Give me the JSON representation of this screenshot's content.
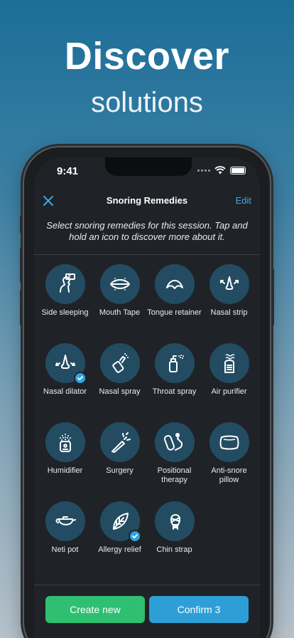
{
  "promo": {
    "title": "Discover",
    "subtitle": "solutions"
  },
  "status_bar": {
    "time": "9:41"
  },
  "nav": {
    "title": "Snoring Remedies",
    "edit_label": "Edit",
    "close_icon": "close-icon"
  },
  "instructions": "Select snoring remedies for this session. Tap and hold an icon to discover more about it.",
  "remedies": [
    {
      "label": "Side sleeping",
      "icon": "side-sleeping-icon",
      "selected": false
    },
    {
      "label": "Mouth Tape",
      "icon": "mouth-tape-icon",
      "selected": false
    },
    {
      "label": "Tongue retainer",
      "icon": "tongue-retainer-icon",
      "selected": false
    },
    {
      "label": "Nasal strip",
      "icon": "nasal-strip-icon",
      "selected": false
    },
    {
      "label": "Nasal dilator",
      "icon": "nasal-dilator-icon",
      "selected": true
    },
    {
      "label": "Nasal spray",
      "icon": "nasal-spray-icon",
      "selected": false
    },
    {
      "label": "Throat spray",
      "icon": "throat-spray-icon",
      "selected": false
    },
    {
      "label": "Air purifier",
      "icon": "air-purifier-icon",
      "selected": false
    },
    {
      "label": "Humidifier",
      "icon": "humidifier-icon",
      "selected": false
    },
    {
      "label": "Surgery",
      "icon": "surgery-icon",
      "selected": false
    },
    {
      "label": "Positional therapy",
      "icon": "positional-therapy-icon",
      "selected": false
    },
    {
      "label": "Anti-snore pillow",
      "icon": "anti-snore-pillow-icon",
      "selected": false
    },
    {
      "label": "Neti pot",
      "icon": "neti-pot-icon",
      "selected": false
    },
    {
      "label": "Allergy relief",
      "icon": "allergy-relief-icon",
      "selected": true
    },
    {
      "label": "Chin strap",
      "icon": "chin-strap-icon",
      "selected": false
    }
  ],
  "buttons": {
    "create": "Create new",
    "confirm": "Confirm 3"
  },
  "colors": {
    "accent": "#2e9fd6",
    "create": "#2fbf71",
    "icon_bg": "#234c62",
    "screen_bg": "#1f2327"
  }
}
